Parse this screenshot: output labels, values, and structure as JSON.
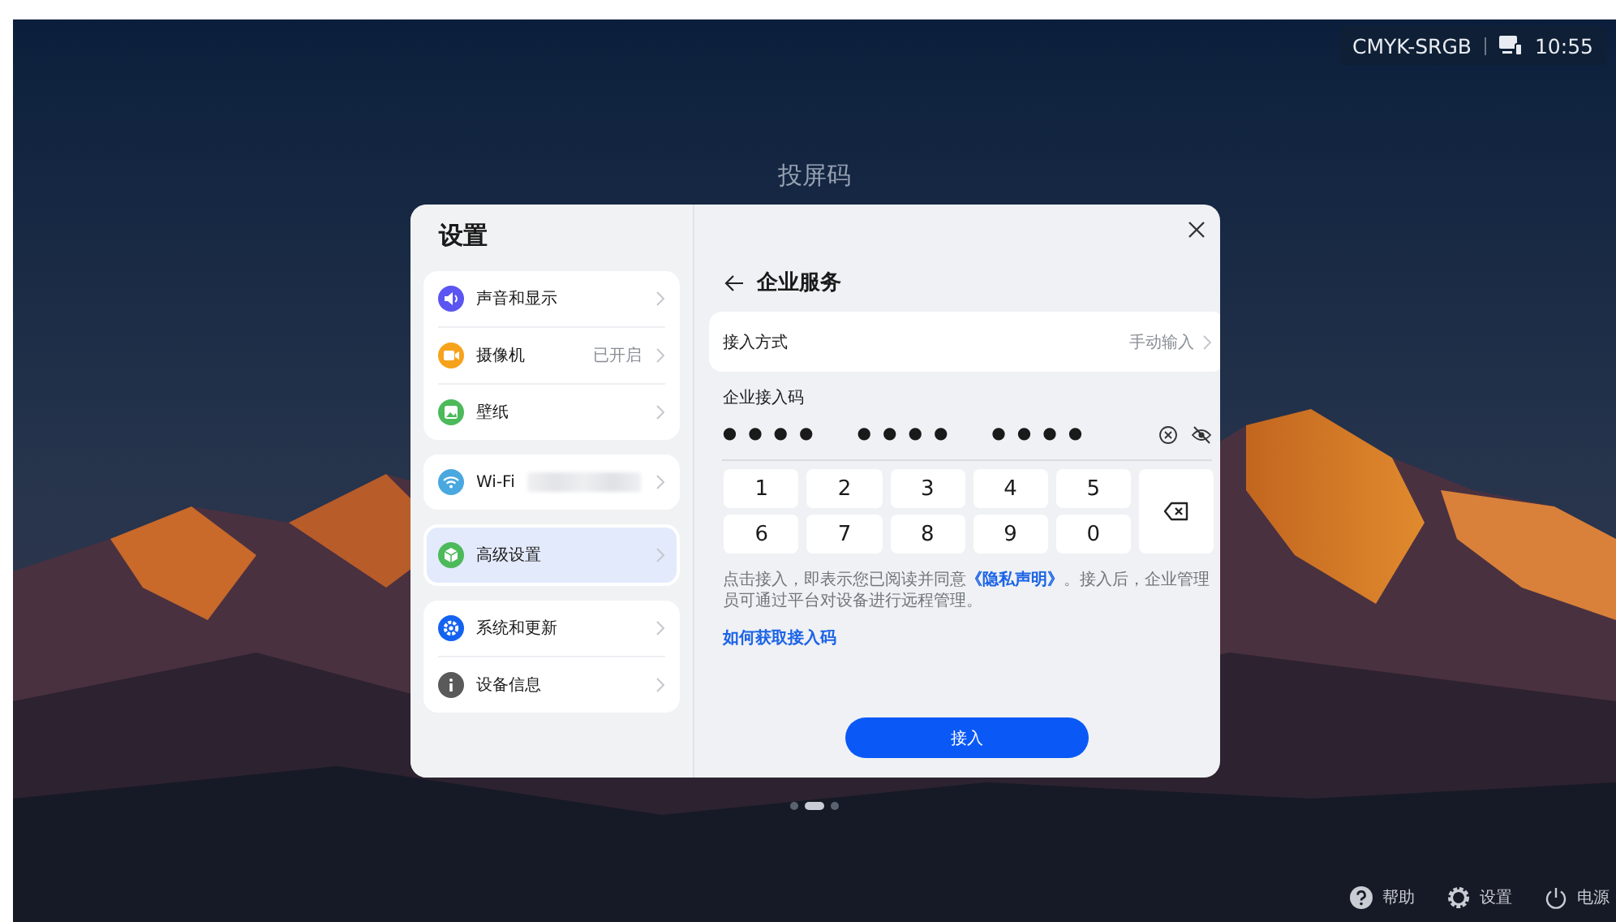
{
  "status_bar": {
    "profile": "CMYK-SRGB",
    "time": "10:55"
  },
  "screen_title": "投屏码",
  "settings": {
    "title": "设置",
    "groups": [
      {
        "items": [
          {
            "label": "声音和显示",
            "color": "#5b55f2",
            "selected": false
          },
          {
            "label": "摄像机",
            "value": "已开启",
            "color": "#f7a21b",
            "selected": false
          },
          {
            "label": "壁纸",
            "color": "#4cba5a",
            "selected": false
          }
        ]
      },
      {
        "items": [
          {
            "label": "Wi-Fi",
            "value_redacted": true,
            "color": "#4aa8e0",
            "selected": false
          }
        ]
      },
      {
        "items": [
          {
            "label": "高级设置",
            "color": "#4cba5a",
            "selected": true
          }
        ]
      },
      {
        "items": [
          {
            "label": "系统和更新",
            "color": "#1462f0",
            "selected": false
          },
          {
            "label": "设备信息",
            "color": "#5a5a5a",
            "selected": false
          }
        ]
      }
    ]
  },
  "enterprise": {
    "title": "企业服务",
    "access_method": {
      "label": "接入方式",
      "value": "手动输入"
    },
    "code_label": "企业接入码",
    "code_groups": [
      "●●●●",
      "●●●●",
      "●●●●"
    ],
    "keys": [
      "1",
      "2",
      "3",
      "4",
      "5",
      "6",
      "7",
      "8",
      "9",
      "0"
    ],
    "notice": "点击接入，即表示您已阅读并同意**《隐私声明》**。接入后，企业管理员可通过平台对设备进行远程管理。",
    "help_link": "如何获取接入码",
    "submit": "接入"
  },
  "pager": [
    {
      "selected": false
    },
    {
      "selected": true
    },
    {
      "selected": false
    }
  ],
  "bottom_bar": [
    {
      "label": "帮助"
    },
    {
      "label": "设置"
    },
    {
      "label": "电源"
    }
  ]
}
